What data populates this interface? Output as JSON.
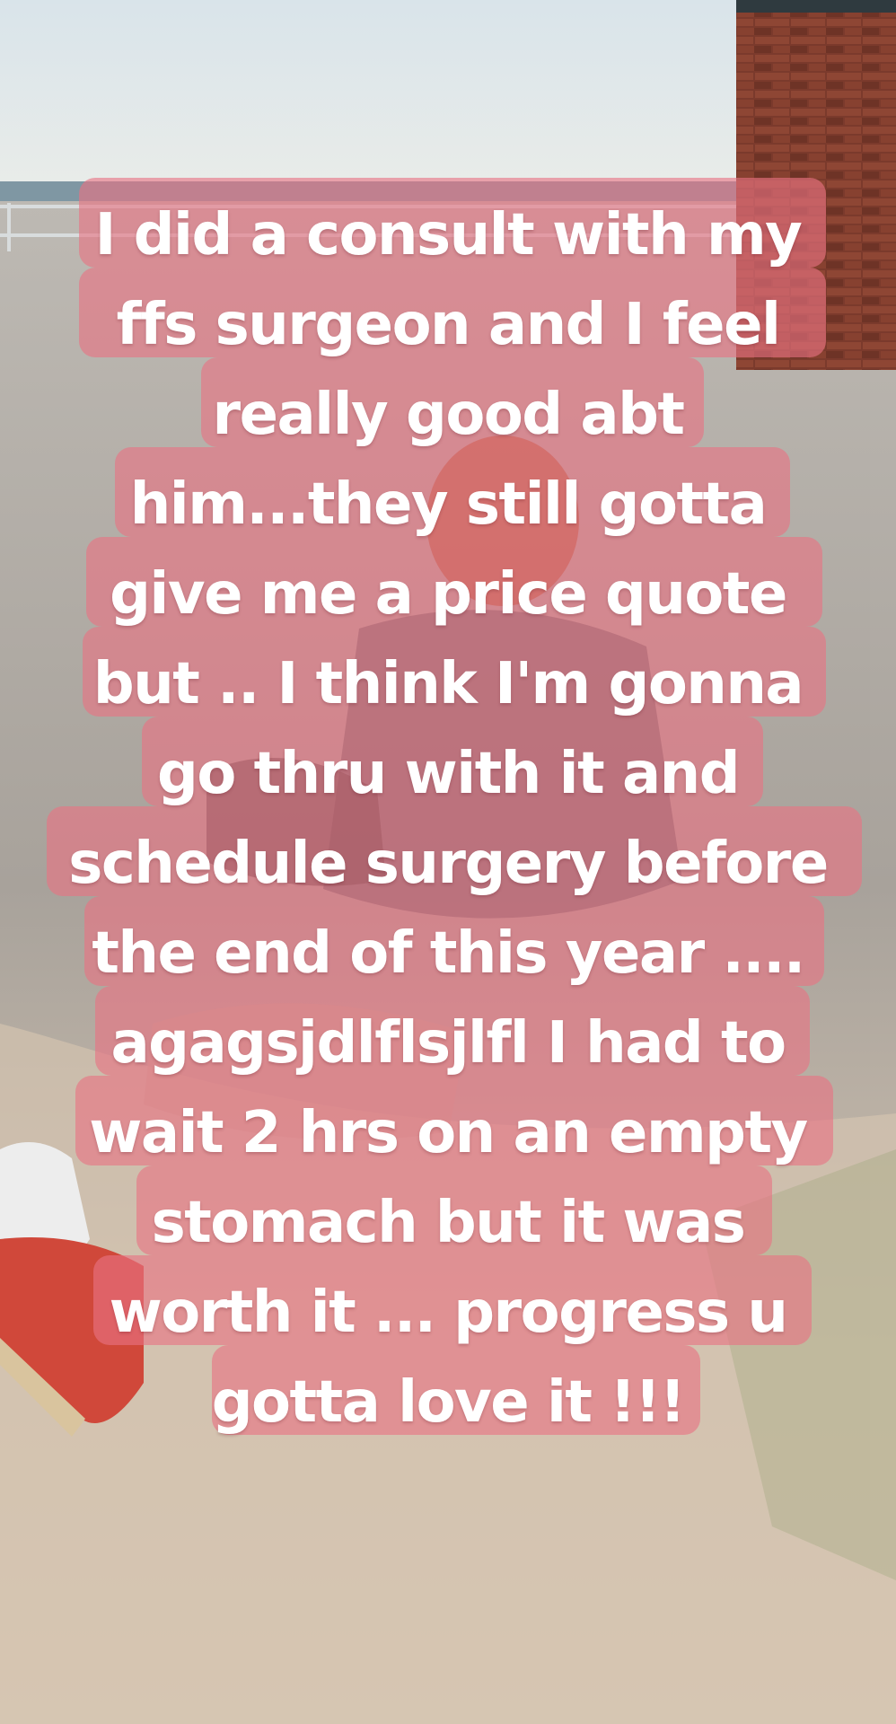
{
  "story": {
    "caption_lines": [
      "I did a consult with my",
      "ffs surgeon and I feel",
      "really good abt",
      "him...they still gotta",
      "give me a price quote",
      "but .. I think I'm gonna",
      "go thru with it and",
      "schedule surgery before",
      "the end of this year ....",
      "agagsjdlflsjlfl I had to",
      "wait 2 hrs on an empty",
      "stomach but it was",
      "worth it ... progress u",
      "gotta love it !!!"
    ],
    "highlight_color": "#e87282",
    "text_color": "#ffffff"
  }
}
